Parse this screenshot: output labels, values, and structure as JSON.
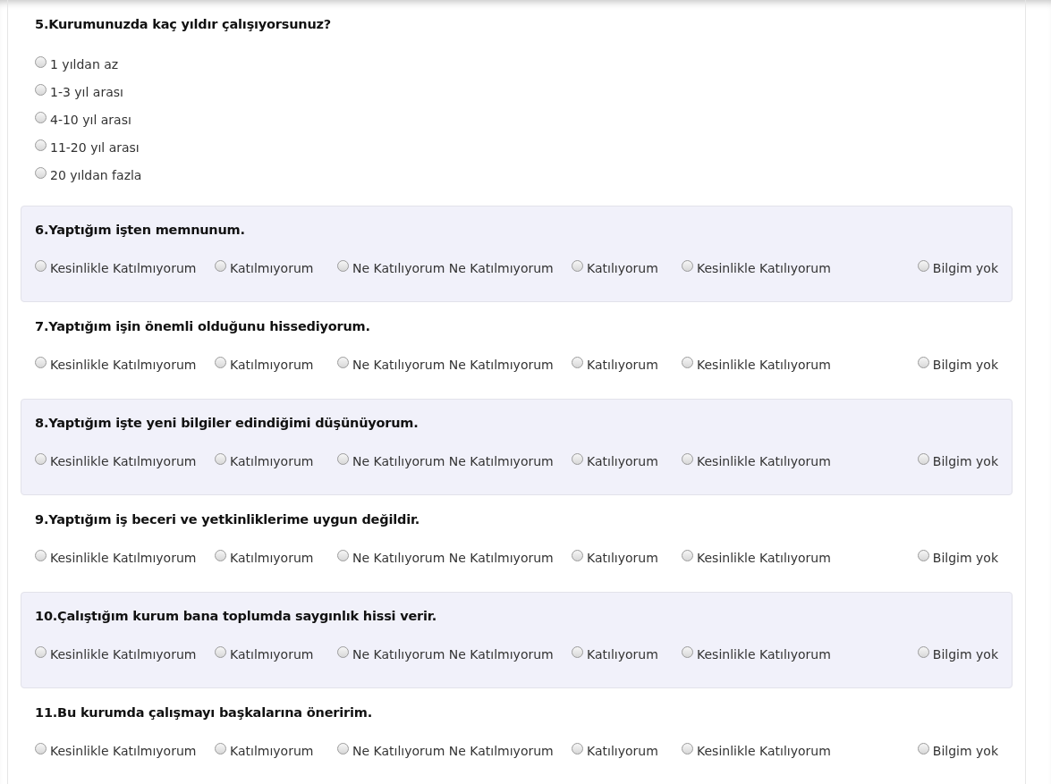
{
  "questions": [
    {
      "kind": "vertical",
      "shaded": false,
      "title": "5.Kurumunuzda kaç yıldır çalışıyorsunuz?",
      "options": [
        {
          "label": "1 yıldan az",
          "selected": false
        },
        {
          "label": "1-3 yıl arası",
          "selected": false
        },
        {
          "label": "4-10 yıl arası",
          "selected": false
        },
        {
          "label": "11-20 yıl arası",
          "selected": false
        },
        {
          "label": "20 yıldan fazla",
          "selected": false
        }
      ]
    },
    {
      "kind": "scale",
      "shaded": true,
      "title": "6.Yaptığım işten memnunum.",
      "options": [
        {
          "label": "Kesinlikle Katılmıyorum",
          "selected": false
        },
        {
          "label": "Katılmıyorum",
          "selected": false
        },
        {
          "label": "Ne Katılıyorum Ne Katılmıyorum",
          "selected": false
        },
        {
          "label": "Katılıyorum",
          "selected": false
        },
        {
          "label": "Kesinlikle Katılıyorum",
          "selected": false
        },
        {
          "label": "Bilgim yok",
          "selected": false
        }
      ]
    },
    {
      "kind": "scale",
      "shaded": false,
      "title": "7.Yaptığım işin önemli olduğunu hissediyorum.",
      "options": [
        {
          "label": "Kesinlikle Katılmıyorum",
          "selected": false
        },
        {
          "label": "Katılmıyorum",
          "selected": false
        },
        {
          "label": "Ne Katılıyorum Ne Katılmıyorum",
          "selected": false
        },
        {
          "label": "Katılıyorum",
          "selected": false
        },
        {
          "label": "Kesinlikle Katılıyorum",
          "selected": false
        },
        {
          "label": "Bilgim yok",
          "selected": false
        }
      ]
    },
    {
      "kind": "scale",
      "shaded": true,
      "title": "8.Yaptığım işte yeni bilgiler edindiğimi düşünüyorum.",
      "options": [
        {
          "label": "Kesinlikle Katılmıyorum",
          "selected": false
        },
        {
          "label": "Katılmıyorum",
          "selected": false
        },
        {
          "label": "Ne Katılıyorum Ne Katılmıyorum",
          "selected": false
        },
        {
          "label": "Katılıyorum",
          "selected": false
        },
        {
          "label": "Kesinlikle Katılıyorum",
          "selected": false
        },
        {
          "label": "Bilgim yok",
          "selected": false
        }
      ]
    },
    {
      "kind": "scale",
      "shaded": false,
      "title": "9.Yaptığım iş beceri ve yetkinliklerime uygun değildir.",
      "options": [
        {
          "label": "Kesinlikle Katılmıyorum",
          "selected": false
        },
        {
          "label": "Katılmıyorum",
          "selected": false
        },
        {
          "label": "Ne Katılıyorum Ne Katılmıyorum",
          "selected": false
        },
        {
          "label": "Katılıyorum",
          "selected": false
        },
        {
          "label": "Kesinlikle Katılıyorum",
          "selected": false
        },
        {
          "label": "Bilgim yok",
          "selected": false
        }
      ]
    },
    {
      "kind": "scale",
      "shaded": true,
      "title": "10.Çalıştığım kurum bana toplumda saygınlık hissi verir.",
      "options": [
        {
          "label": "Kesinlikle Katılmıyorum",
          "selected": false
        },
        {
          "label": "Katılmıyorum",
          "selected": false
        },
        {
          "label": "Ne Katılıyorum Ne Katılmıyorum",
          "selected": false
        },
        {
          "label": "Katılıyorum",
          "selected": false
        },
        {
          "label": "Kesinlikle Katılıyorum",
          "selected": false
        },
        {
          "label": "Bilgim yok",
          "selected": false
        }
      ]
    },
    {
      "kind": "scale",
      "shaded": false,
      "title": "11.Bu kurumda çalışmayı başkalarına öneririm.",
      "options": [
        {
          "label": "Kesinlikle Katılmıyorum",
          "selected": false
        },
        {
          "label": "Katılmıyorum",
          "selected": false
        },
        {
          "label": "Ne Katılıyorum Ne Katılmıyorum",
          "selected": false
        },
        {
          "label": "Katılıyorum",
          "selected": false
        },
        {
          "label": "Kesinlikle Katılıyorum",
          "selected": false
        },
        {
          "label": "Bilgim yok",
          "selected": false
        }
      ]
    }
  ]
}
